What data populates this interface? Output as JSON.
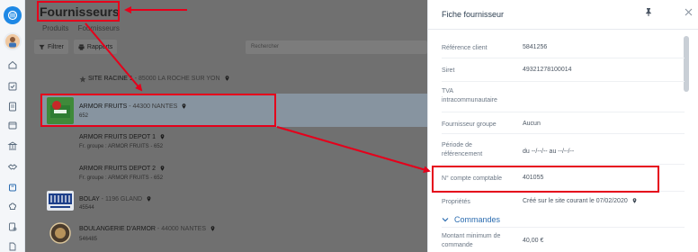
{
  "header": {
    "title": "Fournisseurs",
    "breadcrumb": [
      "Produits",
      "Fournisseurs"
    ]
  },
  "toolbar": {
    "filter_label": "Filtrer",
    "reports_label": "Rapports",
    "search_placeholder": "Rechercher"
  },
  "suppliers": [
    {
      "name": "SITE RACINE 1",
      "city": "85000 LA ROCHE SUR YON",
      "sub": ""
    },
    {
      "name": "ARMOR FRUITS",
      "city": "44300 NANTES",
      "sub": "652"
    },
    {
      "name": "ARMOR FRUITS DEPOT 1",
      "city": "",
      "sub": "Fr. groupe : ARMOR FRUITS - 652"
    },
    {
      "name": "ARMOR FRUITS DEPOT 2",
      "city": "",
      "sub": "Fr. groupe : ARMOR FRUITS - 652"
    },
    {
      "name": "BOLAY",
      "city": "1196 GLAND",
      "sub": "45544"
    },
    {
      "name": "BOULANGERIE D'ARMOR",
      "city": "44000 NANTES",
      "sub": "546485"
    }
  ],
  "panel": {
    "title": "Fiche fournisseur",
    "fields": [
      {
        "label": "Référence client",
        "value": "5841256"
      },
      {
        "label": "Siret",
        "value": "49321278100014"
      },
      {
        "label": "TVA intracommunautaire",
        "value": ""
      },
      {
        "label": "Fournisseur groupe",
        "value": "Aucun"
      },
      {
        "label": "Période de référencement",
        "value": "du  --/--/--  au  --/--/--"
      },
      {
        "label": "N° compte comptable",
        "value": "401055"
      },
      {
        "label": "Propriétés",
        "value": "Créé sur le site courant le 07/02/2020"
      }
    ],
    "section_label": "Commandes",
    "section_fields": [
      {
        "label": "Montant minimum de commande",
        "value": "40,00 €"
      }
    ]
  },
  "colors": {
    "annotation": "#e5001b",
    "accent": "#2b6cb0",
    "selected_row": "#8794a0"
  },
  "icons": [
    "app-logo-icon",
    "avatar",
    "home-icon",
    "checklist-icon",
    "clipboard-icon",
    "calendar-icon",
    "bank-icon",
    "handshake-icon",
    "box-icon",
    "chef-hat-icon",
    "recipe-icon",
    "document-icon",
    "filter-icon",
    "print-icon",
    "location-pin-icon",
    "pin-icon",
    "close-icon",
    "chevron-down-icon"
  ]
}
